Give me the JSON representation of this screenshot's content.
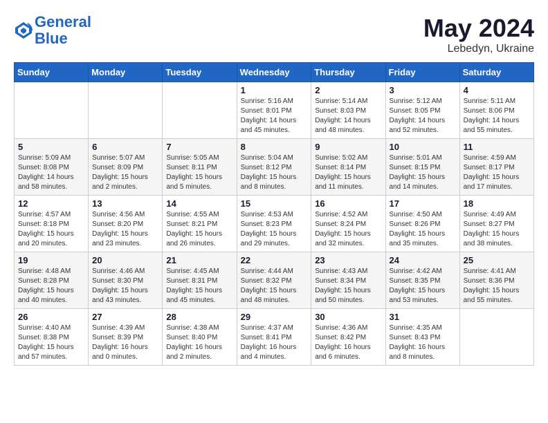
{
  "header": {
    "logo_line1": "General",
    "logo_line2": "Blue",
    "month_year": "May 2024",
    "location": "Lebedyn, Ukraine"
  },
  "weekdays": [
    "Sunday",
    "Monday",
    "Tuesday",
    "Wednesday",
    "Thursday",
    "Friday",
    "Saturday"
  ],
  "weeks": [
    [
      {
        "day": "",
        "info": ""
      },
      {
        "day": "",
        "info": ""
      },
      {
        "day": "",
        "info": ""
      },
      {
        "day": "1",
        "info": "Sunrise: 5:16 AM\nSunset: 8:01 PM\nDaylight: 14 hours and 45 minutes."
      },
      {
        "day": "2",
        "info": "Sunrise: 5:14 AM\nSunset: 8:03 PM\nDaylight: 14 hours and 48 minutes."
      },
      {
        "day": "3",
        "info": "Sunrise: 5:12 AM\nSunset: 8:05 PM\nDaylight: 14 hours and 52 minutes."
      },
      {
        "day": "4",
        "info": "Sunrise: 5:11 AM\nSunset: 8:06 PM\nDaylight: 14 hours and 55 minutes."
      }
    ],
    [
      {
        "day": "5",
        "info": "Sunrise: 5:09 AM\nSunset: 8:08 PM\nDaylight: 14 hours and 58 minutes."
      },
      {
        "day": "6",
        "info": "Sunrise: 5:07 AM\nSunset: 8:09 PM\nDaylight: 15 hours and 2 minutes."
      },
      {
        "day": "7",
        "info": "Sunrise: 5:05 AM\nSunset: 8:11 PM\nDaylight: 15 hours and 5 minutes."
      },
      {
        "day": "8",
        "info": "Sunrise: 5:04 AM\nSunset: 8:12 PM\nDaylight: 15 hours and 8 minutes."
      },
      {
        "day": "9",
        "info": "Sunrise: 5:02 AM\nSunset: 8:14 PM\nDaylight: 15 hours and 11 minutes."
      },
      {
        "day": "10",
        "info": "Sunrise: 5:01 AM\nSunset: 8:15 PM\nDaylight: 15 hours and 14 minutes."
      },
      {
        "day": "11",
        "info": "Sunrise: 4:59 AM\nSunset: 8:17 PM\nDaylight: 15 hours and 17 minutes."
      }
    ],
    [
      {
        "day": "12",
        "info": "Sunrise: 4:57 AM\nSunset: 8:18 PM\nDaylight: 15 hours and 20 minutes."
      },
      {
        "day": "13",
        "info": "Sunrise: 4:56 AM\nSunset: 8:20 PM\nDaylight: 15 hours and 23 minutes."
      },
      {
        "day": "14",
        "info": "Sunrise: 4:55 AM\nSunset: 8:21 PM\nDaylight: 15 hours and 26 minutes."
      },
      {
        "day": "15",
        "info": "Sunrise: 4:53 AM\nSunset: 8:23 PM\nDaylight: 15 hours and 29 minutes."
      },
      {
        "day": "16",
        "info": "Sunrise: 4:52 AM\nSunset: 8:24 PM\nDaylight: 15 hours and 32 minutes."
      },
      {
        "day": "17",
        "info": "Sunrise: 4:50 AM\nSunset: 8:26 PM\nDaylight: 15 hours and 35 minutes."
      },
      {
        "day": "18",
        "info": "Sunrise: 4:49 AM\nSunset: 8:27 PM\nDaylight: 15 hours and 38 minutes."
      }
    ],
    [
      {
        "day": "19",
        "info": "Sunrise: 4:48 AM\nSunset: 8:28 PM\nDaylight: 15 hours and 40 minutes."
      },
      {
        "day": "20",
        "info": "Sunrise: 4:46 AM\nSunset: 8:30 PM\nDaylight: 15 hours and 43 minutes."
      },
      {
        "day": "21",
        "info": "Sunrise: 4:45 AM\nSunset: 8:31 PM\nDaylight: 15 hours and 45 minutes."
      },
      {
        "day": "22",
        "info": "Sunrise: 4:44 AM\nSunset: 8:32 PM\nDaylight: 15 hours and 48 minutes."
      },
      {
        "day": "23",
        "info": "Sunrise: 4:43 AM\nSunset: 8:34 PM\nDaylight: 15 hours and 50 minutes."
      },
      {
        "day": "24",
        "info": "Sunrise: 4:42 AM\nSunset: 8:35 PM\nDaylight: 15 hours and 53 minutes."
      },
      {
        "day": "25",
        "info": "Sunrise: 4:41 AM\nSunset: 8:36 PM\nDaylight: 15 hours and 55 minutes."
      }
    ],
    [
      {
        "day": "26",
        "info": "Sunrise: 4:40 AM\nSunset: 8:38 PM\nDaylight: 15 hours and 57 minutes."
      },
      {
        "day": "27",
        "info": "Sunrise: 4:39 AM\nSunset: 8:39 PM\nDaylight: 16 hours and 0 minutes."
      },
      {
        "day": "28",
        "info": "Sunrise: 4:38 AM\nSunset: 8:40 PM\nDaylight: 16 hours and 2 minutes."
      },
      {
        "day": "29",
        "info": "Sunrise: 4:37 AM\nSunset: 8:41 PM\nDaylight: 16 hours and 4 minutes."
      },
      {
        "day": "30",
        "info": "Sunrise: 4:36 AM\nSunset: 8:42 PM\nDaylight: 16 hours and 6 minutes."
      },
      {
        "day": "31",
        "info": "Sunrise: 4:35 AM\nSunset: 8:43 PM\nDaylight: 16 hours and 8 minutes."
      },
      {
        "day": "",
        "info": ""
      }
    ]
  ]
}
